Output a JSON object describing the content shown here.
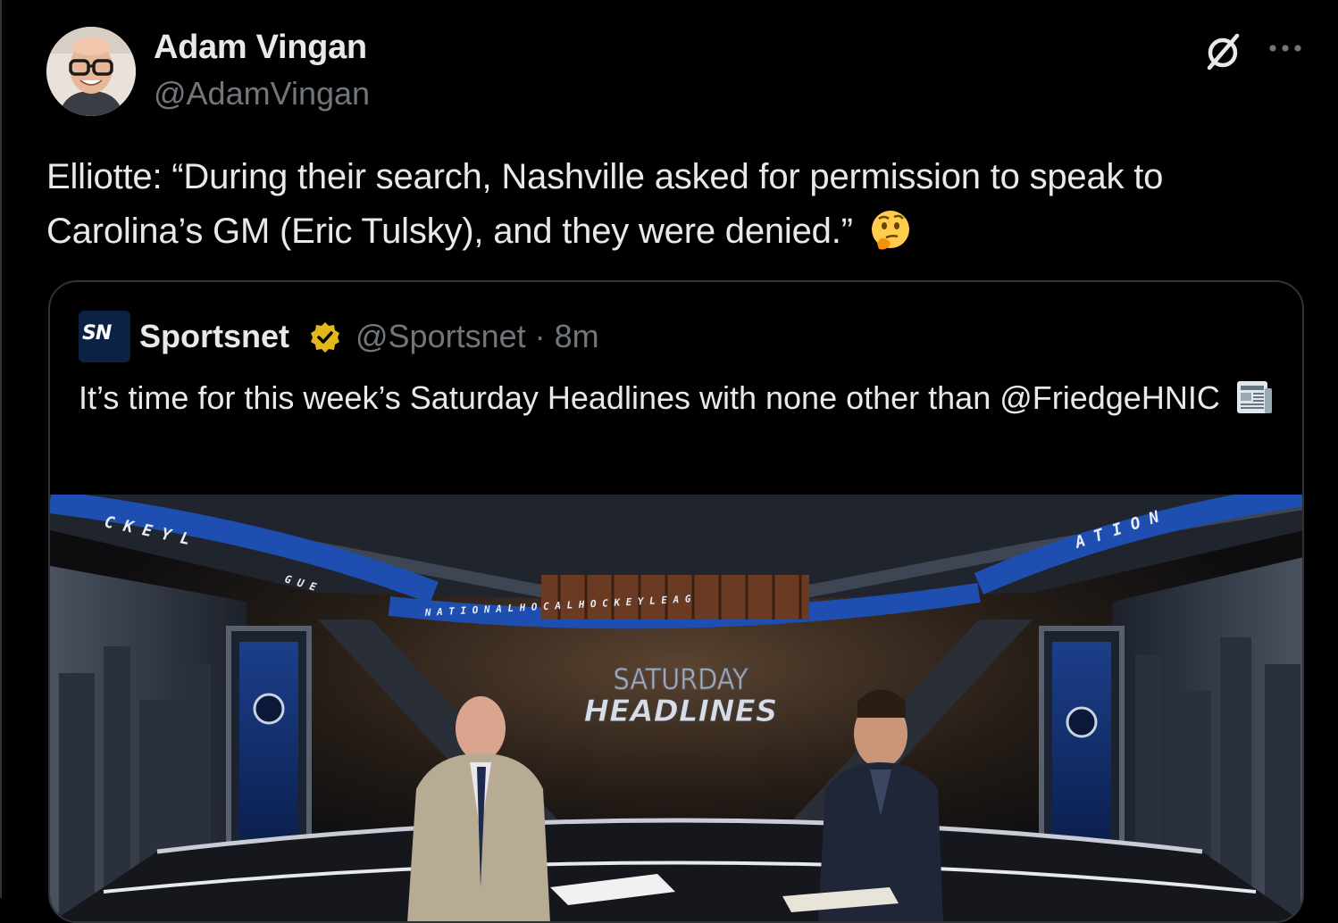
{
  "author": {
    "name": "Adam Vingan",
    "handle": "@AdamVingan"
  },
  "tweet": {
    "text": "Elliotte: “During their search, Nashville asked for permission to speak to Carolina’s GM (Eric Tulsky), and they were denied.”"
  },
  "quoted": {
    "logo_text": "SN",
    "name": "Sportsnet",
    "handle": "@Sportsnet",
    "time": "· 8m",
    "text": "It’s time for this week’s Saturday Headlines with none other than @FriedgeHNIC",
    "media": {
      "banner_top_left": "C K E Y   L",
      "banner_top_left_2": "G U E",
      "banner_top_right": "A T I O N",
      "banner_mid": "N A T I O N A L   H O C     A L   H O C K E Y   L E A G",
      "graphic_line1": "SATURDAY",
      "graphic_line2": "HEADLINES"
    }
  },
  "icons": {
    "grok": "grok-icon",
    "more": "more-icon",
    "verified": "verified-badge-icon",
    "thinking": "thinking-face-emoji",
    "newspaper": "newspaper-emoji"
  },
  "colors": {
    "background": "#000000",
    "text": "#e7e9ea",
    "secondary": "#71767b",
    "border": "#2f3336",
    "verified_gold": "#e2b719"
  }
}
